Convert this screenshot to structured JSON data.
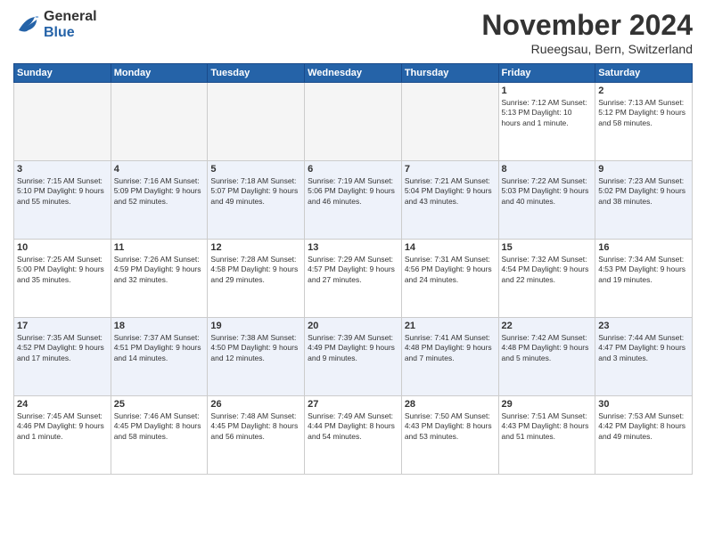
{
  "logo": {
    "general": "General",
    "blue": "Blue"
  },
  "title": "November 2024",
  "subtitle": "Rueegsau, Bern, Switzerland",
  "days_of_week": [
    "Sunday",
    "Monday",
    "Tuesday",
    "Wednesday",
    "Thursday",
    "Friday",
    "Saturday"
  ],
  "weeks": [
    [
      {
        "day": "",
        "info": ""
      },
      {
        "day": "",
        "info": ""
      },
      {
        "day": "",
        "info": ""
      },
      {
        "day": "",
        "info": ""
      },
      {
        "day": "",
        "info": ""
      },
      {
        "day": "1",
        "info": "Sunrise: 7:12 AM\nSunset: 5:13 PM\nDaylight: 10 hours and 1 minute."
      },
      {
        "day": "2",
        "info": "Sunrise: 7:13 AM\nSunset: 5:12 PM\nDaylight: 9 hours and 58 minutes."
      }
    ],
    [
      {
        "day": "3",
        "info": "Sunrise: 7:15 AM\nSunset: 5:10 PM\nDaylight: 9 hours and 55 minutes."
      },
      {
        "day": "4",
        "info": "Sunrise: 7:16 AM\nSunset: 5:09 PM\nDaylight: 9 hours and 52 minutes."
      },
      {
        "day": "5",
        "info": "Sunrise: 7:18 AM\nSunset: 5:07 PM\nDaylight: 9 hours and 49 minutes."
      },
      {
        "day": "6",
        "info": "Sunrise: 7:19 AM\nSunset: 5:06 PM\nDaylight: 9 hours and 46 minutes."
      },
      {
        "day": "7",
        "info": "Sunrise: 7:21 AM\nSunset: 5:04 PM\nDaylight: 9 hours and 43 minutes."
      },
      {
        "day": "8",
        "info": "Sunrise: 7:22 AM\nSunset: 5:03 PM\nDaylight: 9 hours and 40 minutes."
      },
      {
        "day": "9",
        "info": "Sunrise: 7:23 AM\nSunset: 5:02 PM\nDaylight: 9 hours and 38 minutes."
      }
    ],
    [
      {
        "day": "10",
        "info": "Sunrise: 7:25 AM\nSunset: 5:00 PM\nDaylight: 9 hours and 35 minutes."
      },
      {
        "day": "11",
        "info": "Sunrise: 7:26 AM\nSunset: 4:59 PM\nDaylight: 9 hours and 32 minutes."
      },
      {
        "day": "12",
        "info": "Sunrise: 7:28 AM\nSunset: 4:58 PM\nDaylight: 9 hours and 29 minutes."
      },
      {
        "day": "13",
        "info": "Sunrise: 7:29 AM\nSunset: 4:57 PM\nDaylight: 9 hours and 27 minutes."
      },
      {
        "day": "14",
        "info": "Sunrise: 7:31 AM\nSunset: 4:56 PM\nDaylight: 9 hours and 24 minutes."
      },
      {
        "day": "15",
        "info": "Sunrise: 7:32 AM\nSunset: 4:54 PM\nDaylight: 9 hours and 22 minutes."
      },
      {
        "day": "16",
        "info": "Sunrise: 7:34 AM\nSunset: 4:53 PM\nDaylight: 9 hours and 19 minutes."
      }
    ],
    [
      {
        "day": "17",
        "info": "Sunrise: 7:35 AM\nSunset: 4:52 PM\nDaylight: 9 hours and 17 minutes."
      },
      {
        "day": "18",
        "info": "Sunrise: 7:37 AM\nSunset: 4:51 PM\nDaylight: 9 hours and 14 minutes."
      },
      {
        "day": "19",
        "info": "Sunrise: 7:38 AM\nSunset: 4:50 PM\nDaylight: 9 hours and 12 minutes."
      },
      {
        "day": "20",
        "info": "Sunrise: 7:39 AM\nSunset: 4:49 PM\nDaylight: 9 hours and 9 minutes."
      },
      {
        "day": "21",
        "info": "Sunrise: 7:41 AM\nSunset: 4:48 PM\nDaylight: 9 hours and 7 minutes."
      },
      {
        "day": "22",
        "info": "Sunrise: 7:42 AM\nSunset: 4:48 PM\nDaylight: 9 hours and 5 minutes."
      },
      {
        "day": "23",
        "info": "Sunrise: 7:44 AM\nSunset: 4:47 PM\nDaylight: 9 hours and 3 minutes."
      }
    ],
    [
      {
        "day": "24",
        "info": "Sunrise: 7:45 AM\nSunset: 4:46 PM\nDaylight: 9 hours and 1 minute."
      },
      {
        "day": "25",
        "info": "Sunrise: 7:46 AM\nSunset: 4:45 PM\nDaylight: 8 hours and 58 minutes."
      },
      {
        "day": "26",
        "info": "Sunrise: 7:48 AM\nSunset: 4:45 PM\nDaylight: 8 hours and 56 minutes."
      },
      {
        "day": "27",
        "info": "Sunrise: 7:49 AM\nSunset: 4:44 PM\nDaylight: 8 hours and 54 minutes."
      },
      {
        "day": "28",
        "info": "Sunrise: 7:50 AM\nSunset: 4:43 PM\nDaylight: 8 hours and 53 minutes."
      },
      {
        "day": "29",
        "info": "Sunrise: 7:51 AM\nSunset: 4:43 PM\nDaylight: 8 hours and 51 minutes."
      },
      {
        "day": "30",
        "info": "Sunrise: 7:53 AM\nSunset: 4:42 PM\nDaylight: 8 hours and 49 minutes."
      }
    ]
  ]
}
